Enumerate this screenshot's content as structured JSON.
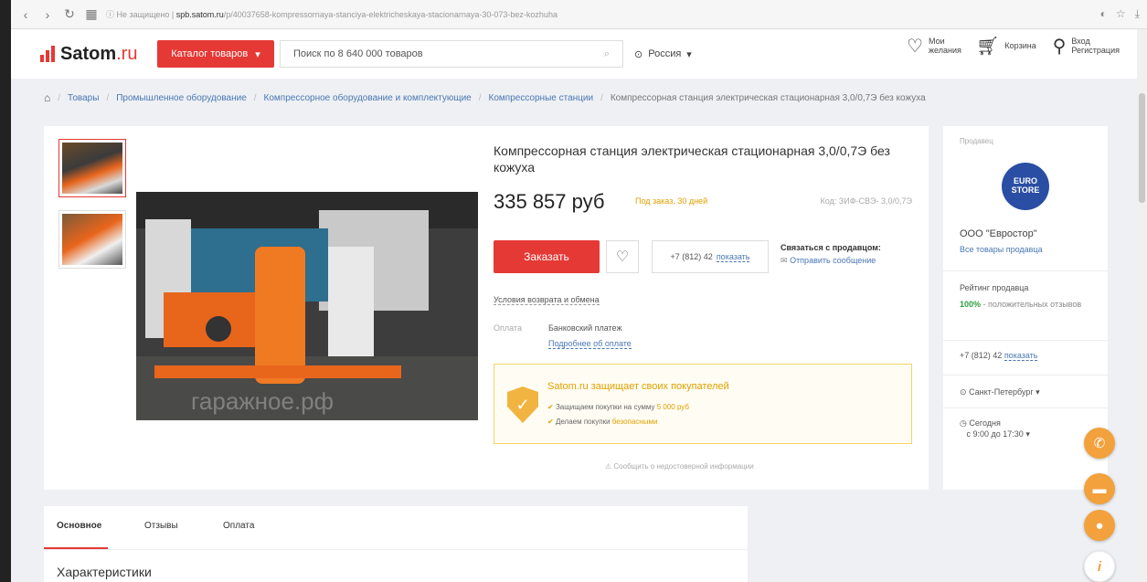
{
  "browser": {
    "url_prefix": "Не защищено",
    "url_host": "spb.satom.ru",
    "url_path": "/p/40037658-kompressornaya-stanciya-elektricheskaya-stacionarnaya-30-073-bez-kozhuha"
  },
  "header": {
    "logo_text": "Satom",
    "logo_suffix": ".ru",
    "catalog_label": "Каталог товаров",
    "search_placeholder": "Поиск по 8 640 000 товаров",
    "region": "Россия",
    "wishlist_label": "Мои желания",
    "cart_label": "Корзина",
    "login_label": "Вход",
    "register_label": "Регистрация"
  },
  "breadcrumbs": [
    "Товары",
    "Промышленное оборудование",
    "Компрессорное оборудование и комплектующие",
    "Компрессорные станции",
    "Компрессорная станция электрическая стационарная 3,0/0,7Э без кожуха"
  ],
  "product": {
    "title": "Компрессорная станция электрическая стационарная 3,0/0,7Э без кожуха",
    "price": "335 857 руб",
    "order_status": "Под заказ, 30 дней",
    "sku": "Код: ЗИФ-СВЭ- 3,0/0,7Э",
    "order_button": "Заказать",
    "phone_prefix": "+7 (812) 42",
    "phone_show": "показать",
    "contact_heading": "Связаться с продавцом:",
    "contact_message": "Отправить сообщение",
    "returns_link": "Условия возврата и обмена",
    "payment_label": "Оплата",
    "payment_method": "Банковский платеж",
    "payment_more": "Подробнее об оплате",
    "watermark": "гаражное.рф",
    "protect_title": "Satom.ru защищает своих покупателей",
    "protect_line1": "Защищаем покупки на сумму",
    "protect_line1_amount": "5 000 руб",
    "protect_line2": "Делаем покупки",
    "protect_line2_hl": "безопасными",
    "report_link": "Сообщить о недостоверной информации"
  },
  "seller": {
    "label": "Продавец",
    "logo_text": "EURO STORE",
    "name": "ООО \"Евростор\"",
    "all_products": "Все товары продавца",
    "rating_label": "Рейтинг продавца",
    "rating_percent": "100%",
    "rating_text": "- положительных отзывов",
    "phone_prefix": "+7 (812) 42",
    "phone_show": "показать",
    "city": "Санкт-Петербург",
    "hours_day": "Сегодня",
    "hours_time": "с 9:00 до 17:30"
  },
  "tabs": {
    "main": "Основное",
    "reviews": "Отзывы",
    "payment": "Оплата"
  },
  "characteristics_heading": "Характеристики",
  "colors": {
    "accent": "#e53935",
    "link": "#4a77b4",
    "warning": "#e0a000",
    "float": "#f2a13c"
  }
}
